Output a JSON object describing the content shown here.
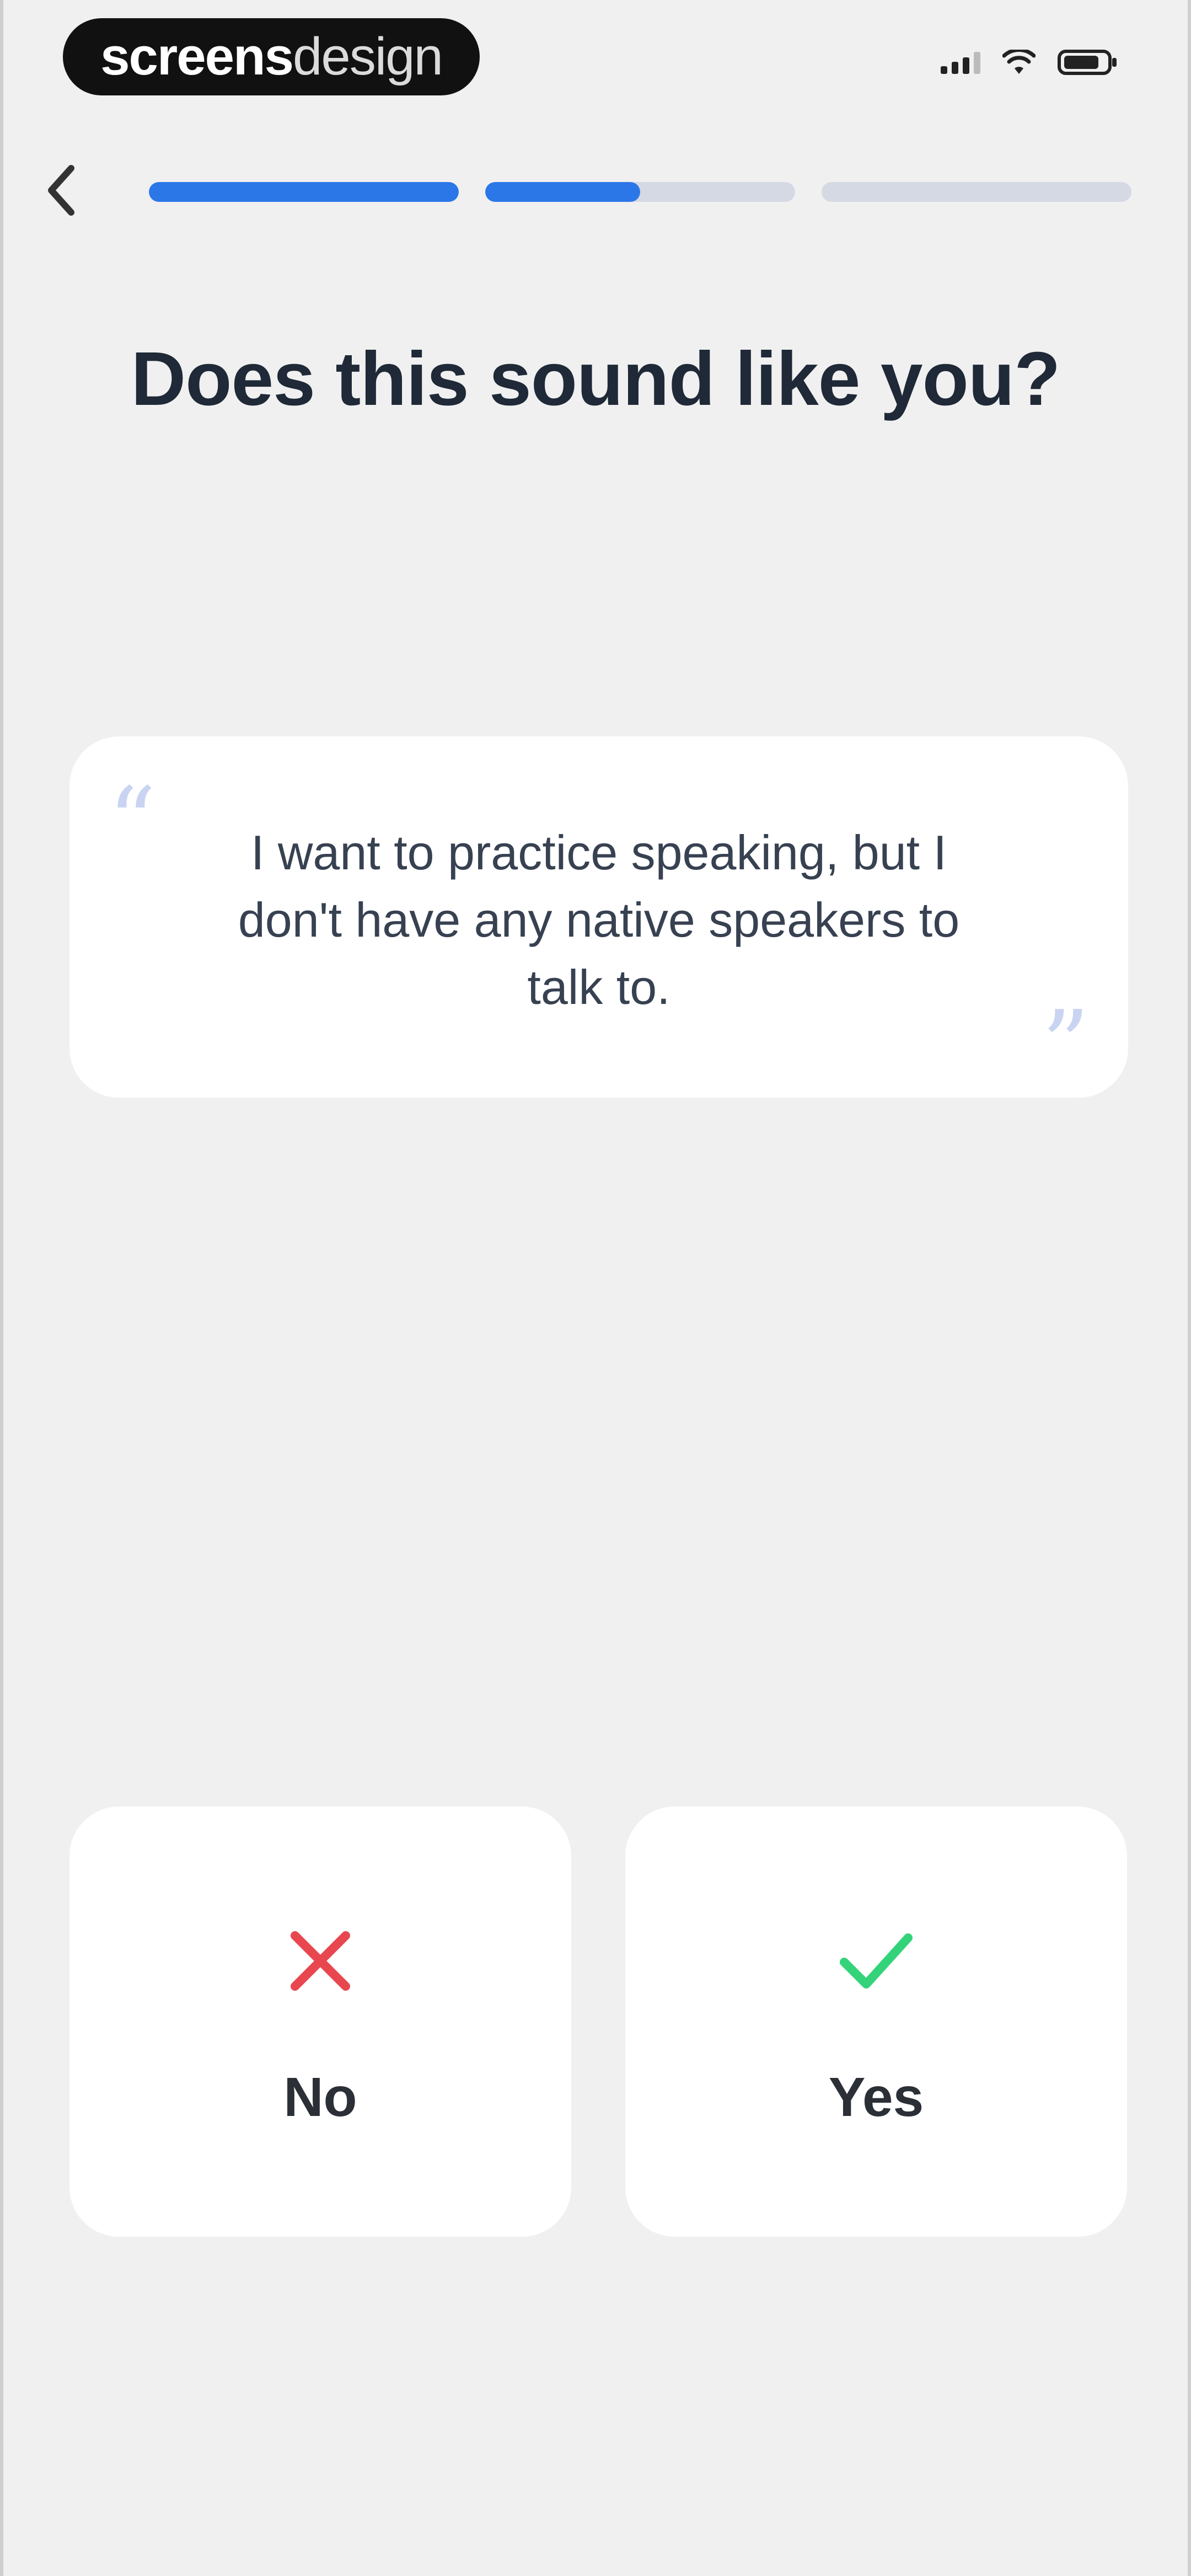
{
  "status_bar": {
    "watermark_bold": "screens",
    "watermark_light": "design",
    "icons": [
      "signal-icon",
      "wifi-icon",
      "battery-icon"
    ]
  },
  "nav": {
    "back_icon": "chevron-left-icon",
    "progress": [
      1.0,
      0.5,
      0.0
    ]
  },
  "title": "Does this sound like you?",
  "quote": {
    "open_mark": "“",
    "text": "I want to practice speaking, but I don't have any native speakers to talk to.",
    "close_mark": "”"
  },
  "answers": {
    "no": {
      "label": "No",
      "icon": "x-icon",
      "color": "#e8474f"
    },
    "yes": {
      "label": "Yes",
      "icon": "check-icon",
      "color": "#34d37a"
    }
  },
  "colors": {
    "accent": "#2c77e8",
    "track": "#d5d9e3",
    "background": "#f0f0f0"
  }
}
